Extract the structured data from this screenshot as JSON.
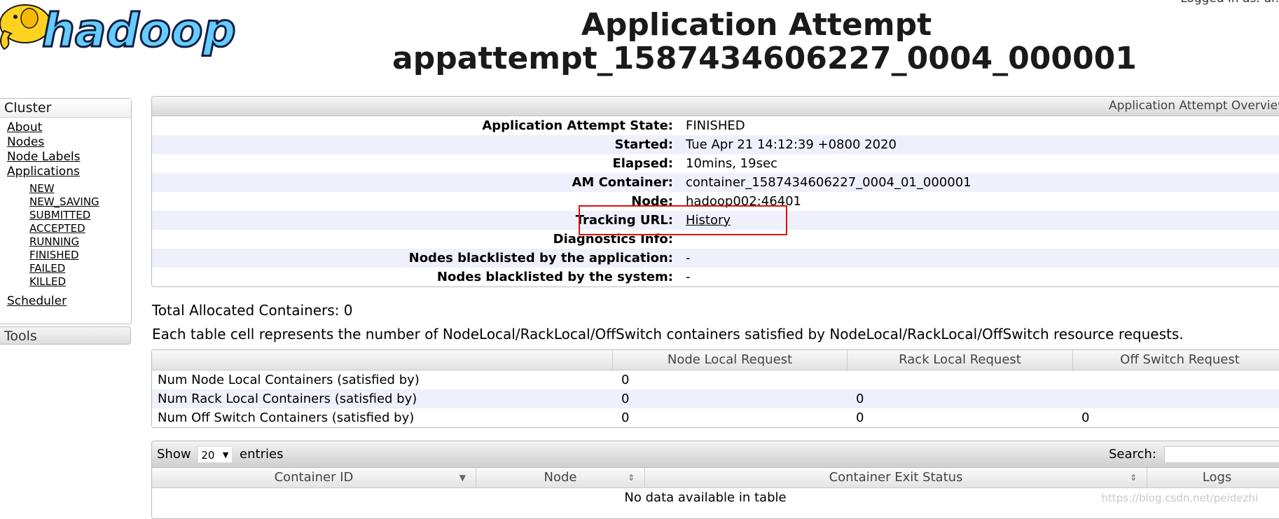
{
  "header": {
    "logo_text": "hadoop",
    "logged_in": "Logged in as: dr.",
    "title_line1": "Application Attempt",
    "title_line2": "appattempt_1587434606227_0004_000001"
  },
  "nav": {
    "cluster_header": "Cluster",
    "items": [
      "About",
      "Nodes",
      "Node Labels",
      "Applications"
    ],
    "app_states": [
      "NEW",
      "NEW_SAVING",
      "SUBMITTED",
      "ACCEPTED",
      "RUNNING",
      "FINISHED",
      "FAILED",
      "KILLED"
    ],
    "scheduler": "Scheduler",
    "tools_header": "Tools"
  },
  "overview": {
    "title": "Application Attempt Overview",
    "rows": [
      {
        "label": "Application Attempt State:",
        "value": "FINISHED"
      },
      {
        "label": "Started:",
        "value": "Tue Apr 21 14:12:39 +0800 2020"
      },
      {
        "label": "Elapsed:",
        "value": "10mins, 19sec"
      },
      {
        "label": "AM Container:",
        "value": "container_1587434606227_0004_01_000001"
      },
      {
        "label": "Node:",
        "value": "hadoop002:46401"
      },
      {
        "label": "Tracking URL:",
        "value": "History"
      },
      {
        "label": "Diagnostics Info:",
        "value": ""
      },
      {
        "label": "Nodes blacklisted by the application:",
        "value": "-"
      },
      {
        "label": "Nodes blacklisted by the system:",
        "value": "-"
      }
    ]
  },
  "containers_summary": {
    "title": "Total Allocated Containers: 0",
    "description": "Each table cell represents the number of NodeLocal/RackLocal/OffSwitch containers satisfied by NodeLocal/RackLocal/OffSwitch resource requests.",
    "columns": [
      "",
      "Node Local Request",
      "Rack Local Request",
      "Off Switch Request"
    ],
    "rows": [
      [
        "Num Node Local Containers (satisfied by)",
        "0",
        "",
        ""
      ],
      [
        "Num Rack Local Containers (satisfied by)",
        "0",
        "0",
        ""
      ],
      [
        "Num Off Switch Containers (satisfied by)",
        "0",
        "0",
        "0"
      ]
    ]
  },
  "containers_table": {
    "show_label": "Show",
    "page_size": "20",
    "entries_label": "entries",
    "search_label": "Search:",
    "columns": [
      "Container ID",
      "Node",
      "Container Exit Status",
      "Logs"
    ],
    "empty_message": "No data available in table"
  },
  "watermark": "https://blog.csdn.net/peidezhi",
  "colors": {
    "highlight_box": "#e01010",
    "row_stripe": "#eef0fb",
    "logo_fill": "#66ccff",
    "logo_elephant": "#ffd21f"
  }
}
